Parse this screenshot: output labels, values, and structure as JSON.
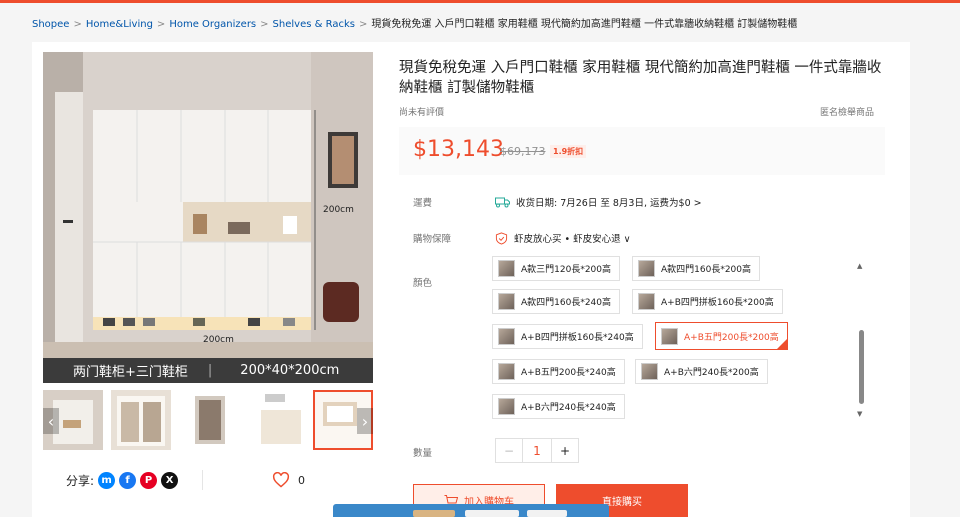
{
  "breadcrumb": {
    "items": [
      "Shopee",
      "Home&Living",
      "Home Organizers",
      "Shelves & Racks"
    ],
    "current": "現貨免稅免運 入戶門口鞋櫃 家用鞋櫃 現代簡約加高進門鞋櫃 一件式靠牆收納鞋櫃 訂製儲物鞋櫃"
  },
  "product": {
    "title": "現貨免稅免運 入戶門口鞋櫃 家用鞋櫃 現代簡約加高進門鞋櫃 一件式靠牆收納鞋櫃 訂製儲物鞋櫃",
    "no_rating": "尚未有評價",
    "report": "匿名檢舉商品",
    "price": "$13,143",
    "original_price": "$69,173",
    "discount": "1.9折扣"
  },
  "gallery": {
    "image_height_label": "200cm",
    "image_floor_label": "200cm",
    "caption_left": "两门鞋柜+三门鞋柜",
    "caption_sep": "|",
    "caption_right": "200*40*200cm"
  },
  "share": {
    "label": "分享:"
  },
  "favorite": {
    "count": "0"
  },
  "shipping": {
    "label": "運費",
    "text": "收货日期: 7月26日 至 8月3日, 运费为$0 >"
  },
  "assurance": {
    "label": "購物保障",
    "text": "虾皮放心买 • 虾皮安心退 ∨"
  },
  "color": {
    "label": "顏色",
    "options": [
      "A款三門120長*200高",
      "A款四門160長*200高",
      "A款四門160長*240高",
      "A+B四門拼板160長*200高",
      "A+B四門拼板160長*240高",
      "A+B五門200長*200高",
      "A+B五門200長*240高",
      "A+B六門240長*200高",
      "A+B六門240長*240高"
    ],
    "selected": "A+B五門200長*200高"
  },
  "quantity": {
    "label": "數量",
    "value": "1",
    "minus": "−",
    "plus": "+"
  },
  "actions": {
    "add_to_cart": "加入購物车",
    "buy_now": "直接購买"
  },
  "colors": {
    "accent": "#ee4d2d"
  }
}
